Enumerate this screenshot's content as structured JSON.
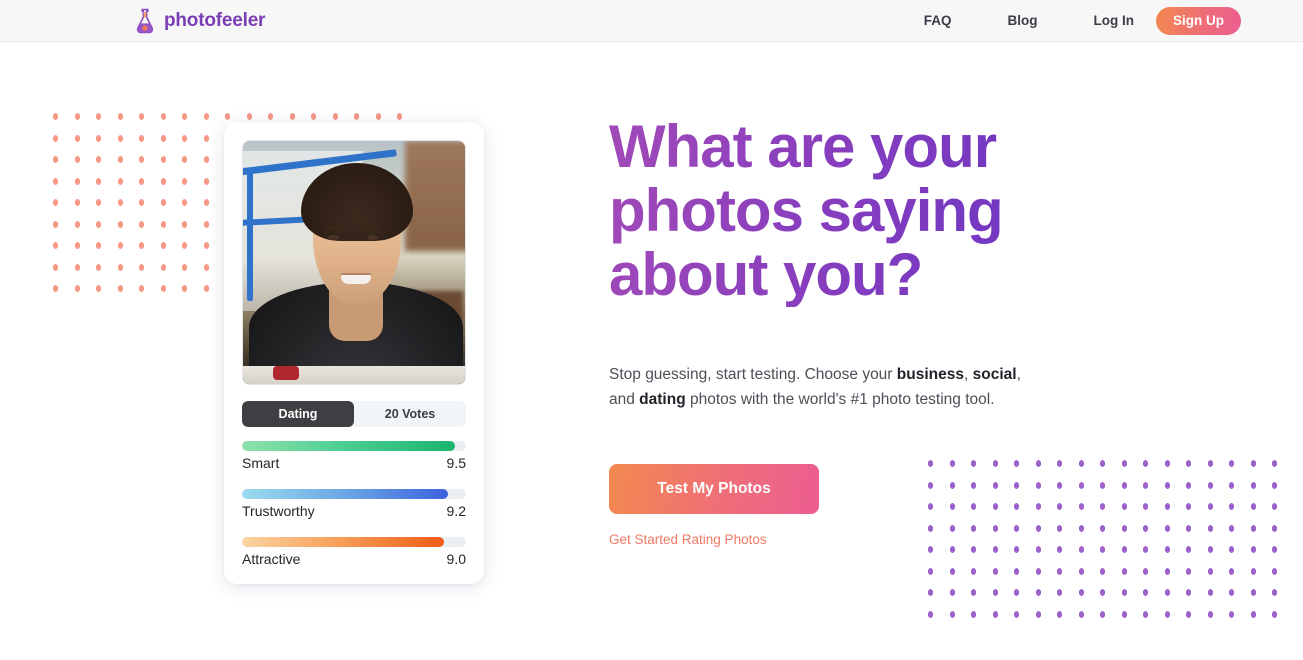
{
  "brand": {
    "name": "photofeeler",
    "logo_icon": "flask-icon",
    "logo_color": "#7b3fb5"
  },
  "header": {
    "nav": [
      {
        "label": "FAQ"
      },
      {
        "label": "Blog"
      },
      {
        "label": "Log In"
      }
    ],
    "signup_label": "Sign Up",
    "signup_gradient": [
      "#f3894f",
      "#ec5d91"
    ]
  },
  "hero": {
    "title_lines": [
      "What are your",
      "photos saying",
      "about you?"
    ],
    "subtitle": {
      "part1": "Stop guessing, start testing. Choose your ",
      "bold1": "business",
      "part2": ", ",
      "bold2": "social",
      "part3": ", and ",
      "bold3": "dating",
      "part4": " photos with the world's #1 photo testing tool."
    },
    "cta_label": "Test My Photos",
    "cta_link_label": "Get Started Rating Photos",
    "cta_link_color": "#ef7a64"
  },
  "photo_card": {
    "photo_alt": "portrait-photo-smiling-man",
    "toggle": [
      {
        "label": "Dating",
        "active": true
      },
      {
        "label": "20 Votes",
        "active": false
      }
    ],
    "ratings": [
      {
        "label": "Smart",
        "value": "9.5",
        "percent": 95,
        "color": "green"
      },
      {
        "label": "Trustworthy",
        "value": "9.2",
        "percent": 92,
        "color": "blue"
      },
      {
        "label": "Attractive",
        "value": "9.0",
        "percent": 90,
        "color": "orange"
      }
    ]
  },
  "decor": {
    "dots_left_color": "#f69886",
    "dots_left_cols": 17,
    "dots_left_rows": 9,
    "dots_right_color": "#9e63cb",
    "dots_right_cols": 17,
    "dots_right_rows": 8
  }
}
